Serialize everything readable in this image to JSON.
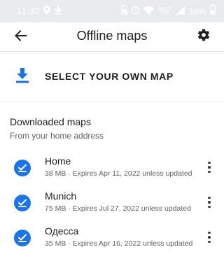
{
  "status_bar": {
    "time": "11:30",
    "battery_percent": "36%",
    "network_label_top": "VoLTE",
    "network_label_bottom": "LTE"
  },
  "app_bar": {
    "title": "Offline maps",
    "back_icon": "arrow-back-icon",
    "settings_icon": "gear-icon"
  },
  "select_own_map": {
    "label": "SELECT YOUR OWN MAP",
    "icon": "download-icon"
  },
  "downloaded": {
    "title": "Downloaded maps",
    "subtitle": "From your home address",
    "items": [
      {
        "name": "Home",
        "meta": "38 MB · Expires Apr 11, 2022 unless updated"
      },
      {
        "name": "Munich",
        "meta": "75 MB · Expires Jul 27, 2022 unless updated"
      },
      {
        "name": "Одесса",
        "meta": "35 MB · Expires Apr 16, 2022 unless updated"
      }
    ]
  },
  "colors": {
    "accent": "#1a73e8",
    "status_bar": "#e8eaed",
    "text_primary": "#202124",
    "text_secondary": "#5f6368"
  }
}
